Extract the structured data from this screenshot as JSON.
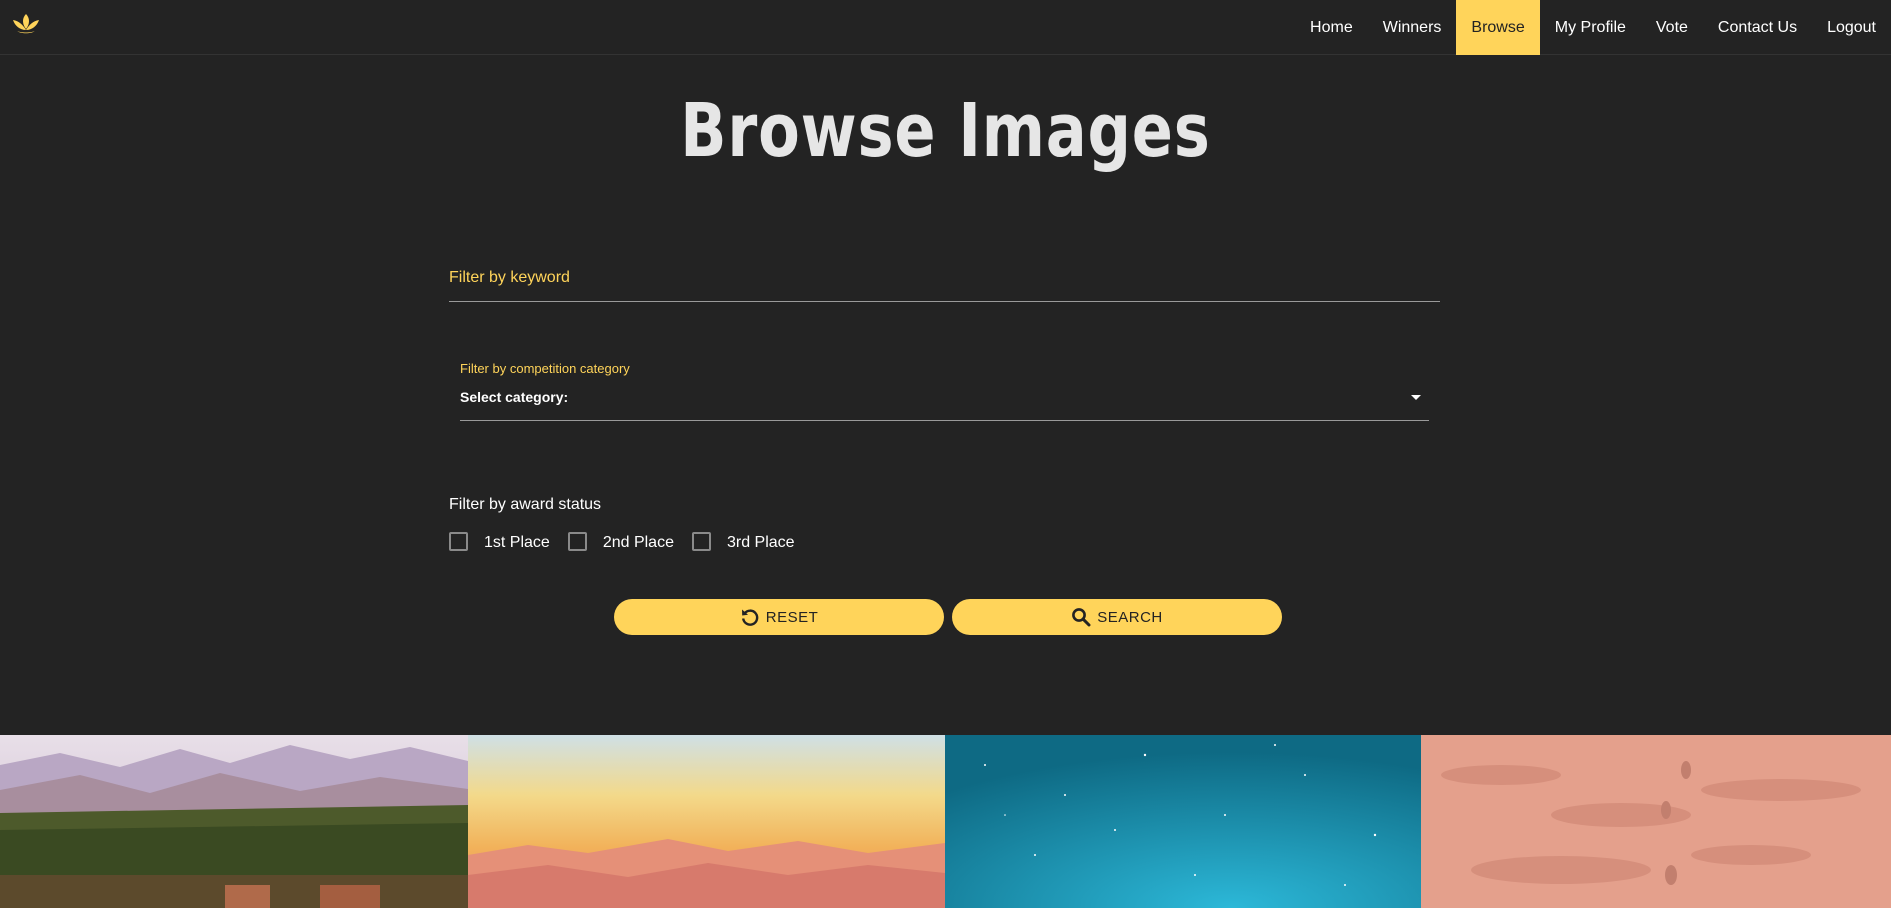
{
  "nav": {
    "logo_icon": "lotus-icon",
    "links": [
      "Home",
      "Winners",
      "Browse",
      "My Profile",
      "Vote",
      "Contact Us",
      "Logout"
    ],
    "active": "Browse"
  },
  "page": {
    "title": "Browse Images"
  },
  "filters": {
    "keyword_placeholder": "Filter by keyword",
    "category_label": "Filter by competition category",
    "category_value": "Select category:",
    "award_title": "Filter by award status",
    "awards": [
      "1st Place",
      "2nd Place",
      "3rd Place"
    ]
  },
  "buttons": {
    "reset": {
      "label": "RESET",
      "icon": "undo-icon"
    },
    "search": {
      "label": "SEARCH",
      "icon": "search-icon"
    }
  },
  "gallery": {
    "images": [
      "oasis-mountains-image",
      "sunset-mountains-image",
      "starry-sky-image",
      "sand-footprints-image"
    ]
  },
  "colors": {
    "background": "#232323",
    "accent": "#ffd45a",
    "text": "#ffffff"
  }
}
